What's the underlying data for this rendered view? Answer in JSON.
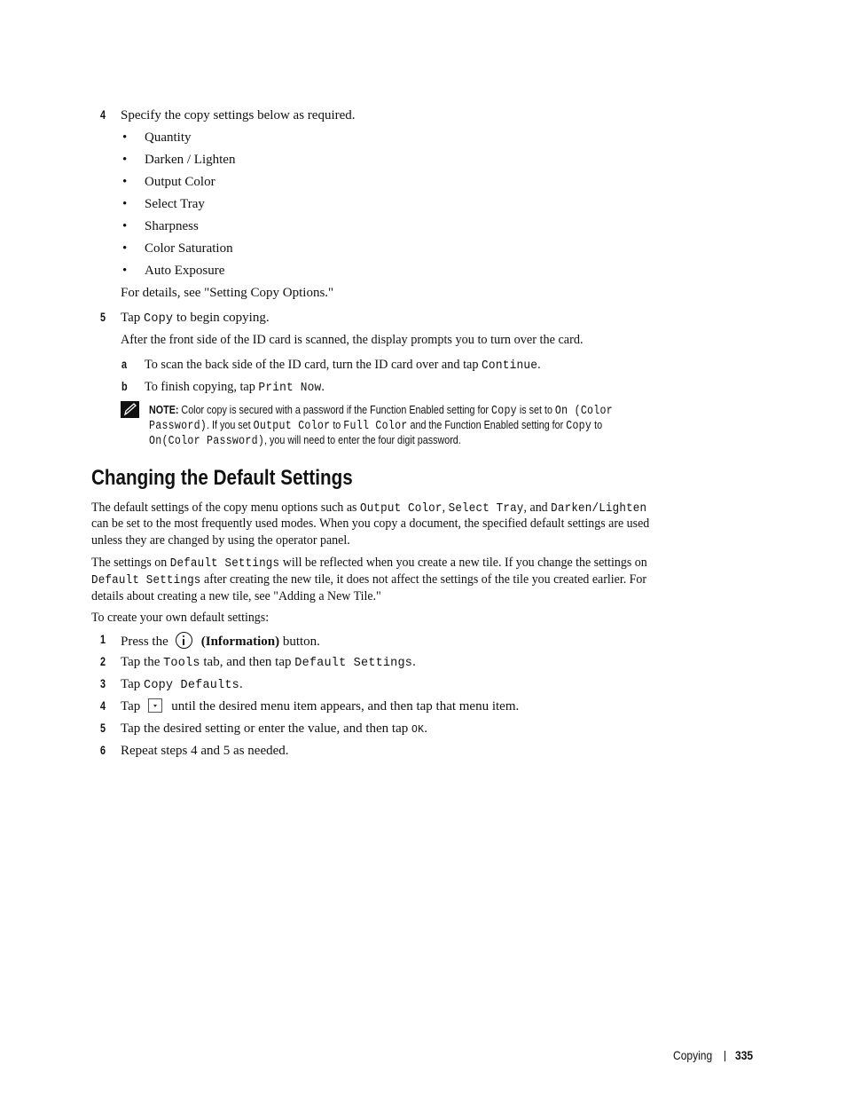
{
  "step4_top": {
    "number": "4",
    "text": "Specify the copy settings below as required.",
    "bullets": [
      "Quantity",
      "Darken / Lighten",
      "Output Color",
      "Select Tray",
      "Sharpness",
      "Color Saturation",
      "Auto Exposure"
    ],
    "details": "For details, see \"Setting Copy Options.\""
  },
  "step5_top": {
    "number": "5",
    "pre": "Tap ",
    "code": "Copy",
    "post": " to begin copying.",
    "para": "After the front side of the ID card is scanned, the display prompts you to turn over the card.",
    "sub_a": {
      "label": "a",
      "pre": "To scan the back side of the ID card, turn the ID card over and tap ",
      "code": "Continue",
      "post": "."
    },
    "sub_b": {
      "label": "b",
      "pre": "To finish copying, tap ",
      "code": "Print Now",
      "post": "."
    }
  },
  "note": {
    "icon": "pencil-note-icon",
    "label": "NOTE:",
    "l1_a": " Color copy is secured with a password if the Function Enabled setting for ",
    "l1_code1": "Copy",
    "l1_b": " is set to ",
    "l1_code2": "On (Color",
    "l2_code1": "Password)",
    "l2_a": ". If you set ",
    "l2_code2": "Output Color",
    "l2_b": " to ",
    "l2_code3": "Full Color",
    "l2_c": " and the Function Enabled setting for ",
    "l2_code4": "Copy",
    "l2_d": " to",
    "l3_code1": "On(Color Password)",
    "l3_a": ", you will need to enter the four digit password."
  },
  "section": {
    "title": "Changing the Default Settings",
    "p1_l1_a": "The default settings of the copy menu options such as ",
    "p1_l1_code1": "Output Color",
    "p1_l1_b": ", ",
    "p1_l1_code2": "Select Tray",
    "p1_l1_c": ", and ",
    "p1_l1_code3": "Darken/Lighten",
    "p1_l2": "can be set to the most frequently used modes. When you copy a document, the specified default settings are used",
    "p1_l3": "unless they are changed by using the operator panel.",
    "p2_l1_a": "The settings on ",
    "p2_l1_code": "Default Settings",
    "p2_l1_b": " will be reflected when you create a new tile. If you change the settings on",
    "p2_l2_code": "Default Settings",
    "p2_l2_a": " after creating the new tile, it does not affect the settings of the tile you created earlier. For",
    "p2_l3": "details about creating a new tile, see \"Adding a New Tile.\"",
    "p3": "To create your own default settings:"
  },
  "steps": [
    {
      "number": "1",
      "pre": "Press the",
      "icon": "information-icon",
      "bold": "(Information)",
      "post": " button."
    },
    {
      "number": "2",
      "pre": "Tap the ",
      "code1": "Tools",
      "mid": " tab, and then tap ",
      "code2": "Default Settings",
      "post": "."
    },
    {
      "number": "3",
      "pre": "Tap ",
      "code": "Copy Defaults",
      "post": "."
    },
    {
      "number": "4",
      "pre": "Tap",
      "icon": "scroll-down-button-icon",
      "post": "until the desired menu item appears, and then tap that menu item."
    },
    {
      "number": "5",
      "pre": "Tap the desired setting or enter the value, and then tap ",
      "code": "OK",
      "post": "."
    },
    {
      "number": "6",
      "text": "Repeat steps 4 and 5 as needed."
    }
  ],
  "footer": {
    "section": "Copying",
    "page": "335"
  }
}
